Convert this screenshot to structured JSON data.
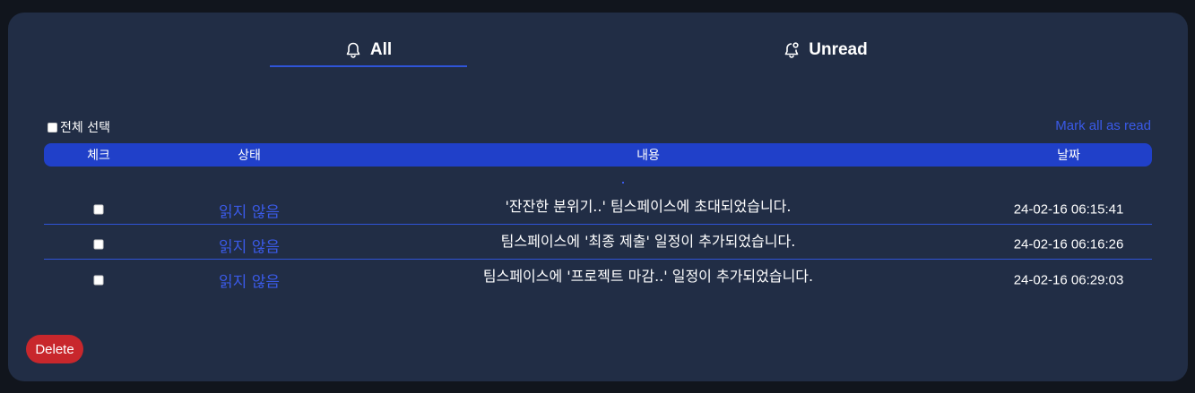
{
  "tabs": [
    {
      "label": "All",
      "icon": "bell-icon",
      "active": true
    },
    {
      "label": "Unread",
      "icon": "bell-dot-icon",
      "active": false
    }
  ],
  "toolbar": {
    "select_all_label": "전체 선택",
    "mark_all_label": "Mark all as read"
  },
  "table": {
    "headers": [
      "체크",
      "상태",
      "내용",
      "날짜"
    ],
    "rows": [
      {
        "status": "읽지 않음",
        "content": "'잔잔한 분위기..' 팀스페이스에 초대되었습니다.",
        "date": "24-02-16 06:15:41",
        "checked": false
      },
      {
        "status": "읽지 않음",
        "content": "팀스페이스에 '최종 제출' 일정이 추가되었습니다.",
        "date": "24-02-16 06:16:26",
        "checked": false
      },
      {
        "status": "읽지 않음",
        "content": "팀스페이스에 '프로젝트 마감..' 일정이 추가되었습니다.",
        "date": "24-02-16 06:29:03",
        "checked": false
      }
    ]
  },
  "actions": {
    "delete_label": "Delete"
  },
  "colors": {
    "accent": "#2040c9",
    "link": "#3a5ae8",
    "danger": "#c8272c",
    "panel": "#212d45"
  }
}
